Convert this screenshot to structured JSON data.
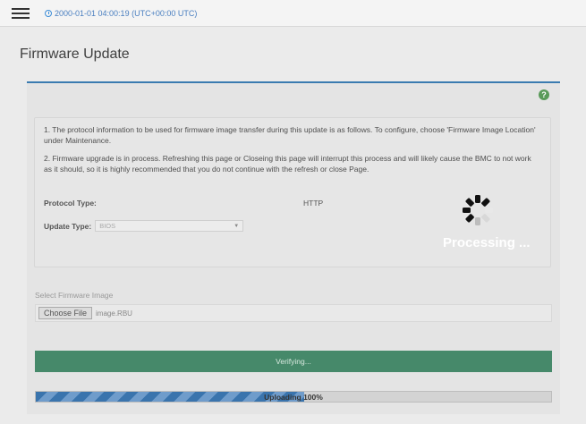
{
  "header": {
    "datetime": "2000-01-01 04:00:19 (UTC+00:00 UTC)"
  },
  "page": {
    "title": "Firmware Update"
  },
  "info": {
    "paragraph1": "1. The protocol information to be used for firmware image transfer during this update is as follows. To configure, choose 'Firmware Image Location' under Maintenance.",
    "paragraph2": "2. Firmware upgrade is in process. Refreshing this page or Closeing this page will interrupt this process and will likely cause the BMC to not work as it should, so it is highly recommended that you do not continue with the refresh or close Page.",
    "protocol_label": "Protocol Type:",
    "protocol_value": "HTTP",
    "update_type_label": "Update Type:",
    "update_type_value": "BIOS"
  },
  "firmware": {
    "label": "Select Firmware Image",
    "choose_button": "Choose File",
    "file_name": "image.RBU"
  },
  "verify_button": "Verifying...",
  "progress": {
    "label": "Uploading 100%",
    "percent": 52
  },
  "overlay": {
    "processing_text": "Processing ..."
  },
  "colors": {
    "accent": "#3b7bb0",
    "verify_green": "#46896a",
    "help_green": "#5a9a5a"
  },
  "icons": {
    "menu": "hamburger-menu-icon",
    "clock": "clock-icon",
    "help": "help-icon",
    "spinner": "loading-spinner-icon",
    "dropdown": "chevron-down-icon"
  }
}
